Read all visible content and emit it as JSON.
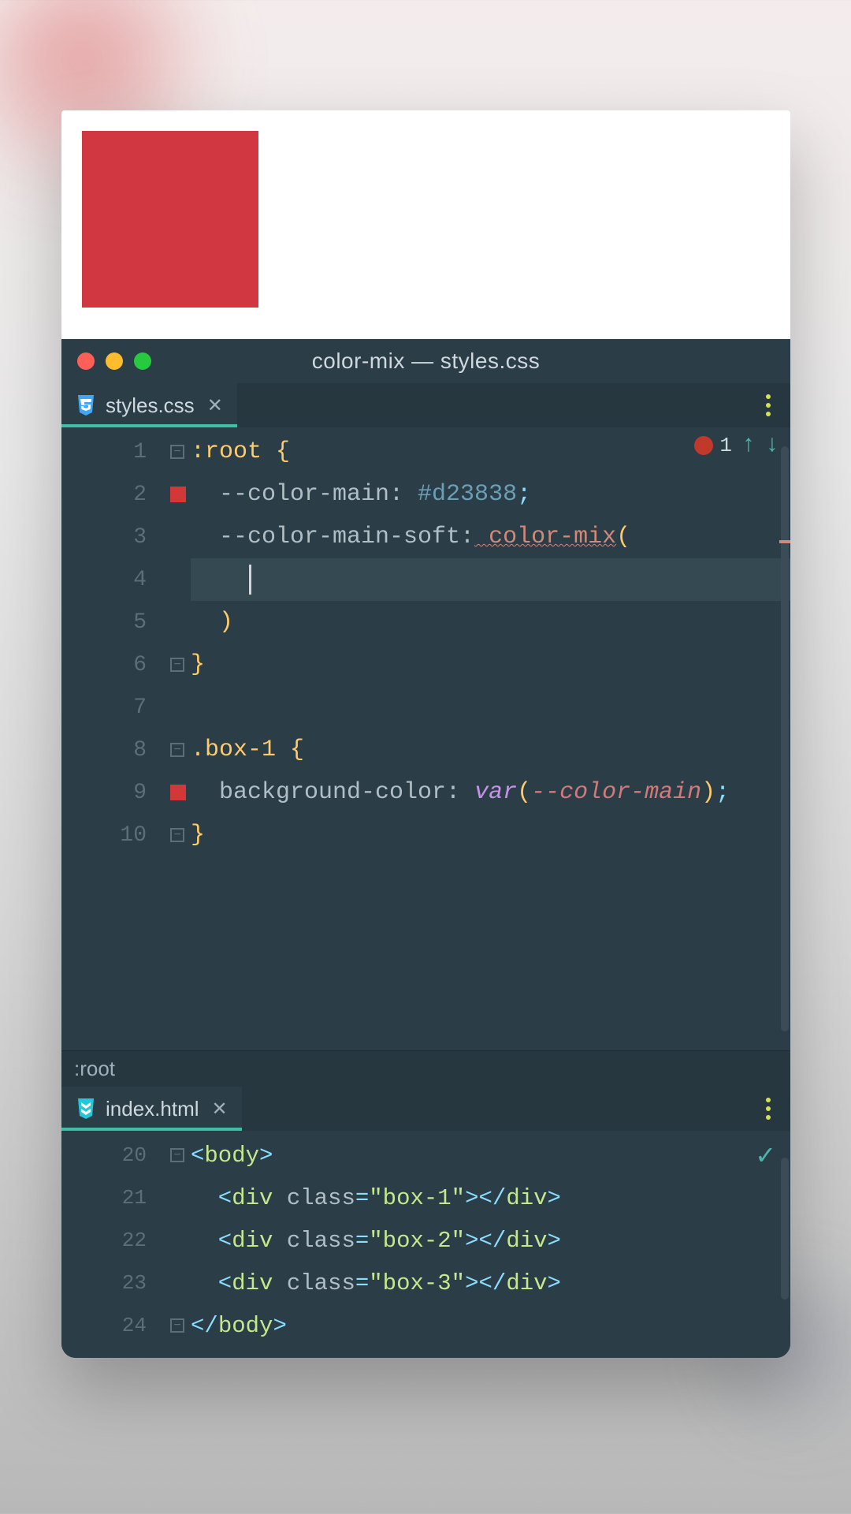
{
  "preview": {
    "swatch_color": "#d03740"
  },
  "window": {
    "title": "color-mix — styles.css"
  },
  "editor_top": {
    "tab": {
      "filename": "styles.css"
    },
    "line_numbers": [
      "1",
      "2",
      "3",
      "4",
      "5",
      "6",
      "7",
      "8",
      "9",
      "10"
    ],
    "lines": {
      "l1": {
        "sel": ":root",
        "brace": " {"
      },
      "l2": {
        "prop": "  --color-main:",
        "val": " #d23838",
        "semi": ";"
      },
      "l3": {
        "prop": "  --color-main-soft:",
        "fn": " color-mix",
        "paren": "("
      },
      "l4": {
        "indent": "    "
      },
      "l5": {
        "paren": "  )"
      },
      "l6": {
        "brace": "}"
      },
      "l8": {
        "sel": ".box-1",
        "brace": " {"
      },
      "l9": {
        "prop": "  background-color:",
        "kw": " var",
        "open": "(",
        "var": "--color-main",
        "close": ")",
        "semi": ";"
      },
      "l10": {
        "brace": "}"
      }
    },
    "problems": {
      "error_count": "1"
    },
    "breadcrumb": ":root"
  },
  "editor_bottom": {
    "tab": {
      "filename": "index.html"
    },
    "line_numbers": [
      "20",
      "21",
      "22",
      "23",
      "24"
    ],
    "lines": {
      "l20": {
        "open": "<",
        "tag": "body",
        "close": ">"
      },
      "l21": {
        "open": "  <",
        "tag": "div",
        "attr": " class",
        "eq": "=",
        "str": "\"box-1\"",
        "mid": "></",
        "tag2": "div",
        "end": ">"
      },
      "l22": {
        "open": "  <",
        "tag": "div",
        "attr": " class",
        "eq": "=",
        "str": "\"box-2\"",
        "mid": "></",
        "tag2": "div",
        "end": ">"
      },
      "l23": {
        "open": "  <",
        "tag": "div",
        "attr": " class",
        "eq": "=",
        "str": "\"box-3\"",
        "mid": "></",
        "tag2": "div",
        "end": ">"
      },
      "l24": {
        "open": "</",
        "tag": "body",
        "close": ">"
      }
    }
  }
}
